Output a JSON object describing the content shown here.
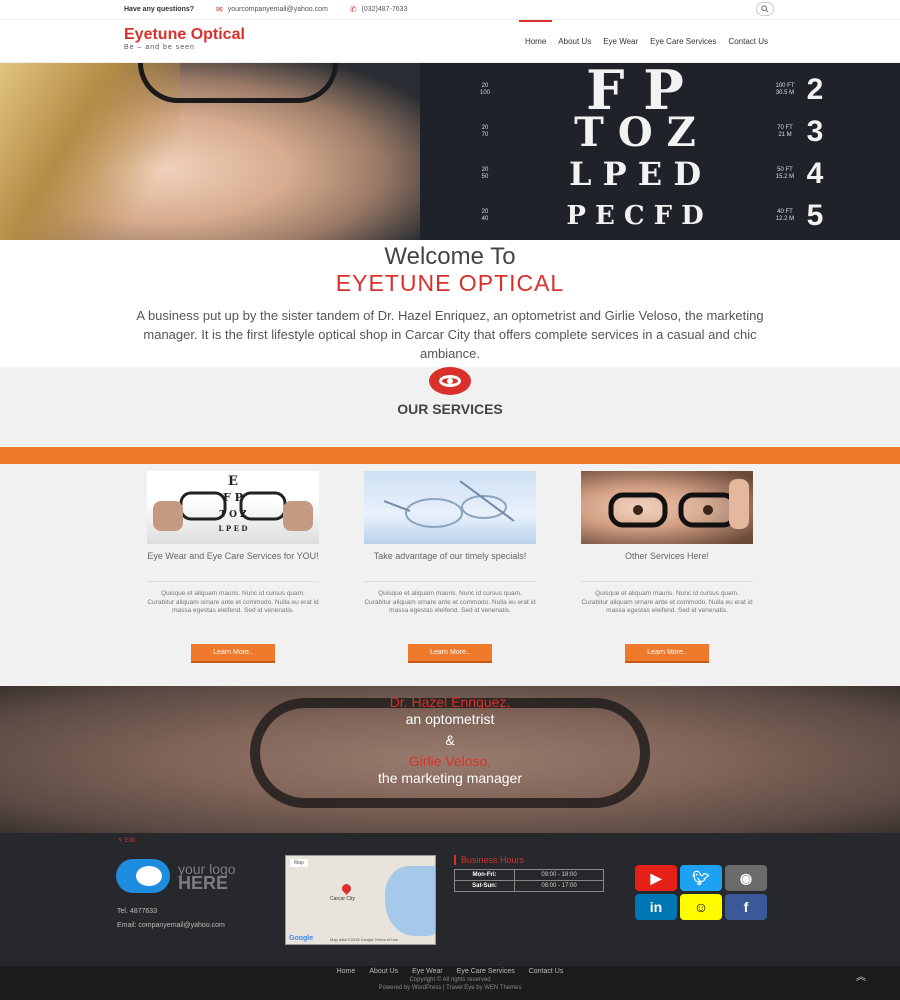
{
  "topbar": {
    "question": "Have any questions?",
    "email": "yourcompanyemail@yahoo.com",
    "phone": "(032)487-7633",
    "icons": [
      "envelope-icon",
      "phone-icon",
      "search-icon"
    ]
  },
  "header": {
    "brand": "Eyetune Optical",
    "tagline": "Be – and be seen",
    "nav": [
      "Home",
      "About Us",
      "Eye Wear",
      "Eye Care Services",
      "Contact Us"
    ],
    "active": "Home",
    "accent": "#d9302c"
  },
  "hero": {
    "chart_rows": [
      {
        "left": [
          "20",
          "100"
        ],
        "letters": "F P",
        "right": [
          "100 FT",
          "30.5 M"
        ],
        "line": "2"
      },
      {
        "left": [
          "20",
          "70"
        ],
        "letters": "T O Z",
        "right": [
          "70 FT",
          "21 M"
        ],
        "line": "3"
      },
      {
        "left": [
          "20",
          "50"
        ],
        "letters": "L P E D",
        "right": [
          "50 FT",
          "15.2 M"
        ],
        "line": "4"
      },
      {
        "left": [
          "20",
          "40"
        ],
        "letters": "P E C F D",
        "right": [
          "40 FT",
          "12.2 M"
        ],
        "line": "5"
      }
    ]
  },
  "welcome": {
    "line1": "Welcome To",
    "line2": "EYETUNE OPTICAL",
    "description": "A business put up by the sister tandem of Dr. Hazel Enriquez, an optometrist and Girlie Veloso, the marketing manager. It is the first lifestyle optical shop in Carcar City that offers complete services in a casual and chic ambiance."
  },
  "services": {
    "title": "OUR SERVICES",
    "accent": "#ef7a2c",
    "cards": [
      {
        "title": "Eye Wear and Eye Care Services for YOU!",
        "text": "Quisque et aliquam mauris. Nunc id cursus quam. Curabitur aliquam ornare ante et commodo. Nulla eu erat id massa egestas eleifend. Sed id venenatis.",
        "button": "Learn More.."
      },
      {
        "title": "Take advantage of our timely specials!",
        "text": "Quisque et aliquam mauris. Nunc id cursus quam. Curabitur aliquam ornare ante et commodo. Nulla eu erat id massa egestas eleifend. Sed id venenatis.",
        "button": "Learn More.."
      },
      {
        "title": "Other Services Here!",
        "text": "Quisque et aliquam mauris. Nunc id cursus quam. Curabitur aliquam ornare ante et commodo. Nulla eu erat id massa egestas eleifend. Sed id venenatis.",
        "button": "Learn More.."
      }
    ]
  },
  "founders": {
    "name1": "Dr. Hazel Enriquez,",
    "role1": "an optometrist",
    "amp": "&",
    "name2": "Girlie Veloso,",
    "role2": "the marketing manager"
  },
  "footer": {
    "edit": "Edit",
    "logo_line1": "your logo",
    "logo_line2": "HERE",
    "tel": "Tel. 4877633",
    "email": "Email: companyemail@yahoo.com",
    "map": {
      "tag": "Map",
      "city": "Carcar City",
      "google": "Google",
      "data": "Map data ©2016 Google   Terms of Use"
    },
    "hours_title": "Business Hours",
    "hours": [
      {
        "day": "Mon-Fri:",
        "time": "09:00 - 18:00"
      },
      {
        "day": "Sat-Sun:",
        "time": "08:00 - 17:00"
      }
    ],
    "social": [
      "youtube-icon",
      "twitter-icon",
      "instagram-icon",
      "linkedin-icon",
      "snapchat-icon",
      "facebook-icon"
    ]
  },
  "bottom": {
    "links": [
      "Home",
      "About Us",
      "Eye Wear",
      "Eye Care Services",
      "Contact Us"
    ],
    "copyright": "Copyright © All rights reserved",
    "powered": "Powered by WordPress | Travel Eye by WEN Themes"
  }
}
